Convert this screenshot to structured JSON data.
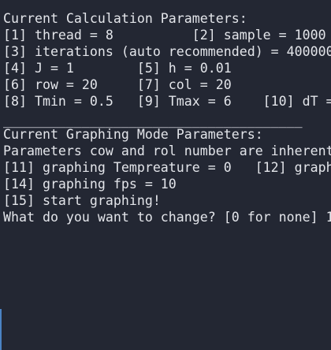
{
  "terminal": {
    "lines": [
      "Current Calculation Parameters:",
      "[1] thread = 8          [2] sample = 1000",
      "[3] iterations (auto recommended) = 400000",
      "[4] J = 1        [5] h = 0.01",
      "[6] row = 20     [7] col = 20",
      "[8] Tmin = 0.5   [9] Tmax = 6    [10] dT =",
      "______________________________________",
      "Current Graphing Mode Parameters:",
      "Parameters cow and rol number are inherent",
      "[11] graphing Tempreature = 0   [12] graph",
      "[14] graphing fps = 10",
      "[15] start graphing!",
      "What do you want to change? [0 for none] 1"
    ]
  },
  "colors": {
    "background": "#232733",
    "foreground": "#e3e5ea",
    "edge_accent": "#4b83c4"
  }
}
